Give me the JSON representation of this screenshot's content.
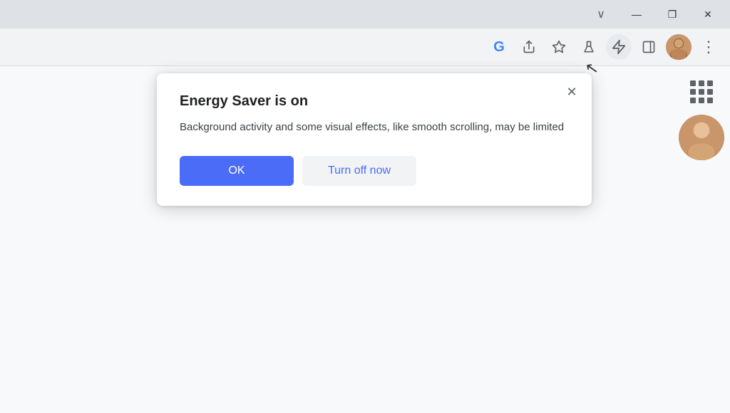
{
  "titlebar": {
    "chevron_label": "∨",
    "minimize_label": "—",
    "maximize_label": "❐",
    "close_label": "✕"
  },
  "toolbar": {
    "google_icon_letter": "G",
    "share_icon": "⤴",
    "star_icon": "☆",
    "labs_icon": "⚗",
    "energy_icon": "⚡",
    "sidebar_icon": "▭",
    "more_icon": "⋮"
  },
  "popup": {
    "close_icon": "✕",
    "title": "Energy Saver is on",
    "body": "Background activity and some visual effects, like smooth scrolling, may be limited",
    "ok_label": "OK",
    "turnoff_label": "Turn off now"
  },
  "dots_grid": [
    1,
    2,
    3,
    4,
    5,
    6,
    7,
    8,
    9
  ]
}
